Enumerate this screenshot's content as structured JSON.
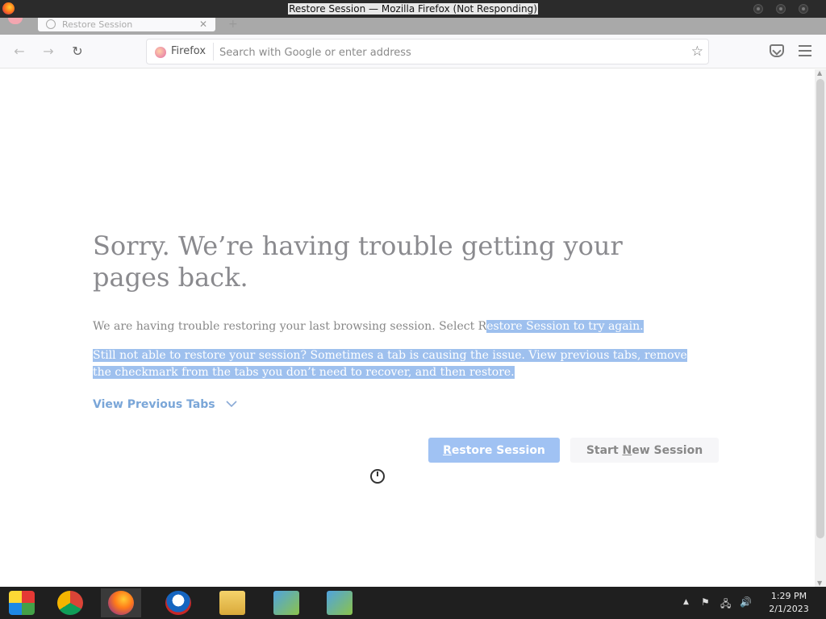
{
  "window": {
    "title": "Restore Session — Mozilla Firefox (Not Responding)"
  },
  "tabs": [
    {
      "title": "Restore Session"
    }
  ],
  "navbar": {
    "identity_label": "Firefox",
    "url_placeholder": "Search with Google or enter address",
    "url_value": ""
  },
  "page": {
    "heading": "Sorry. We’re having trouble getting your pages back.",
    "para1_plain": "We are having trouble restoring your last browsing session. Select R",
    "para1_highlight": "estore Session to try again.",
    "para2": "Still not able to restore your session? Sometimes a tab is causing the issue. View previous tabs, remove the checkmark from the tabs you don’t need to recover, and then restore.",
    "view_previous_tabs": "View Previous Tabs",
    "restore_button": {
      "pre": "",
      "accel": "R",
      "post": "estore Session"
    },
    "new_session_button": {
      "pre": "Start ",
      "accel": "N",
      "post": "ew Session"
    }
  },
  "taskbar": {
    "items": [
      "start-icon",
      "chrome-icon",
      "firefox-icon",
      "obama-logo-icon",
      "file-explorer-icon",
      "installer-icon",
      "installer-icon"
    ],
    "clock_time": "1:29 PM",
    "clock_date": "2/1/2023"
  },
  "colors": {
    "accent": "#a0c2f3",
    "selection": "#9ec0ee",
    "titlebar": "#2b2b2b",
    "taskbar": "#1f1f1f"
  }
}
